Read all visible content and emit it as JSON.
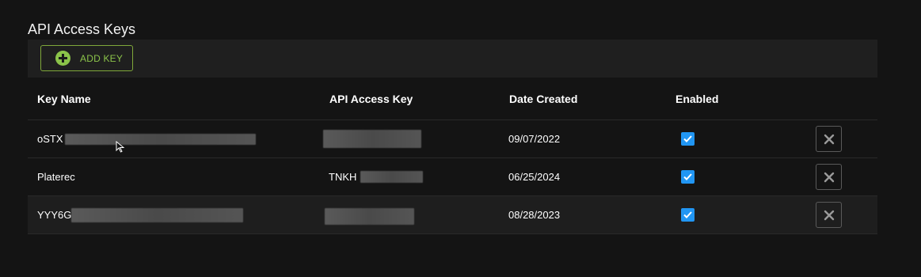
{
  "page": {
    "title": "API Access Keys"
  },
  "toolbar": {
    "add_key_label": "ADD KEY"
  },
  "table": {
    "columns": [
      "Key Name",
      "API Access Key",
      "Date Created",
      "Enabled"
    ],
    "rows": [
      {
        "key_name": "oSTX",
        "api_key": "",
        "date_created": "09/07/2022",
        "enabled": true
      },
      {
        "key_name": "Platerec",
        "api_key": "TNKH",
        "date_created": "06/25/2024",
        "enabled": true
      },
      {
        "key_name": "YYY6G",
        "api_key": "",
        "date_created": "08/28/2023",
        "enabled": true
      }
    ]
  },
  "colors": {
    "background": "#141414",
    "toolbar": "#1f1f1f",
    "accent_green": "#8bc34a",
    "checkbox_blue": "#2196f3"
  },
  "icons": {
    "add": "plus-circle-icon",
    "enabled": "checkbox-checked-icon",
    "delete": "close-icon",
    "cursor": "mouse-pointer-icon"
  }
}
